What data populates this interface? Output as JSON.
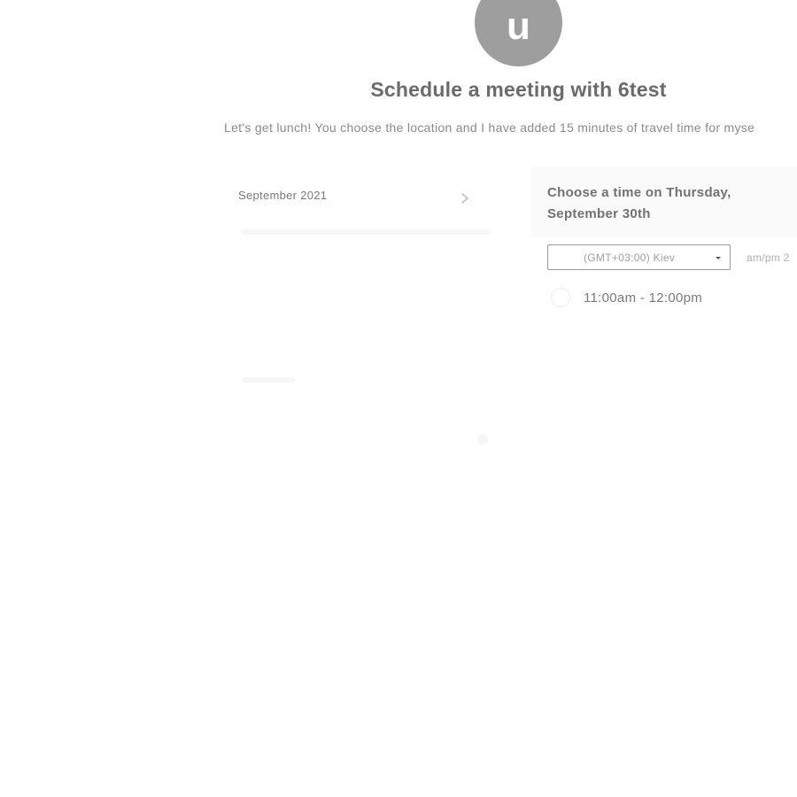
{
  "avatar": {
    "initial": "u"
  },
  "header": {
    "title": "Schedule a meeting with 6test",
    "description": "Let's get lunch! You choose the location and I have added 15 minutes of travel time for myse"
  },
  "calendar": {
    "month_label": "September 2021",
    "next_icon": "chevron-right-icon"
  },
  "time_panel": {
    "heading": "Choose a time on Thursday, September 30th",
    "timezone": {
      "selected": "(GMT+03:00) Kiev",
      "caret_icon": "caret-down-icon"
    },
    "ampm_label": "am/pm  2",
    "slots": [
      {
        "label": "11:00am - 12:00pm"
      }
    ]
  },
  "colors": {
    "avatar_bg": "#9e9e9e",
    "title_text": "#6b6b6b",
    "panel_bg": "#fafafa",
    "select_border": "#9a9a9a"
  }
}
